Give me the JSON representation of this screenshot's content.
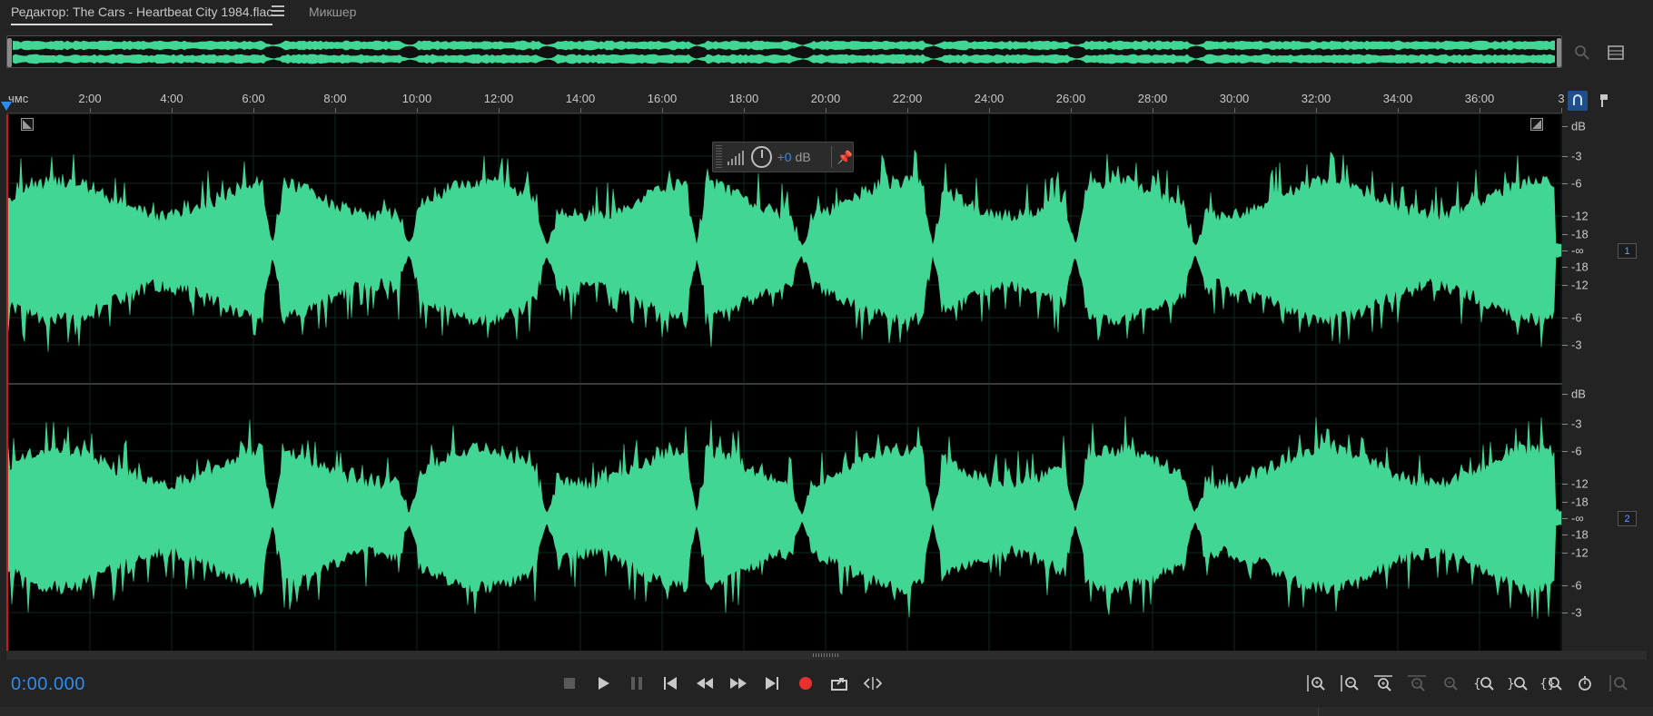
{
  "tabs": {
    "editor_label": "Редактор: The Cars - Heartbeat City 1984.flac",
    "mixer_label": "Микшер"
  },
  "ruler": {
    "unit_label": "чмс",
    "ticks": [
      "2:00",
      "4:00",
      "6:00",
      "8:00",
      "10:00",
      "12:00",
      "14:00",
      "16:00",
      "18:00",
      "20:00",
      "22:00",
      "24:00",
      "26:00",
      "28:00",
      "30:00",
      "32:00",
      "34:00",
      "36:00",
      "3"
    ]
  },
  "hud": {
    "value": "+0",
    "unit": "dB"
  },
  "db_scale": {
    "header": "dB",
    "labels": [
      "-3",
      "-6",
      "-12",
      "-18",
      "-∞",
      "-18",
      "-12",
      "-6",
      "-3"
    ]
  },
  "channels": [
    {
      "badge": "1"
    },
    {
      "badge": "2"
    }
  ],
  "transport": {
    "timecode": "0:00.000",
    "buttons": [
      "stop-icon",
      "play-icon",
      "pause-icon",
      "go-to-start-icon",
      "rewind-icon",
      "fast-forward-icon",
      "go-to-end-icon",
      "record-icon",
      "loop-icon",
      "skip-selection-icon"
    ]
  },
  "colors": {
    "waveform": "#41d694",
    "accent": "#2d8cf0",
    "record": "#e8312f",
    "playhead": "#c41e1e"
  }
}
